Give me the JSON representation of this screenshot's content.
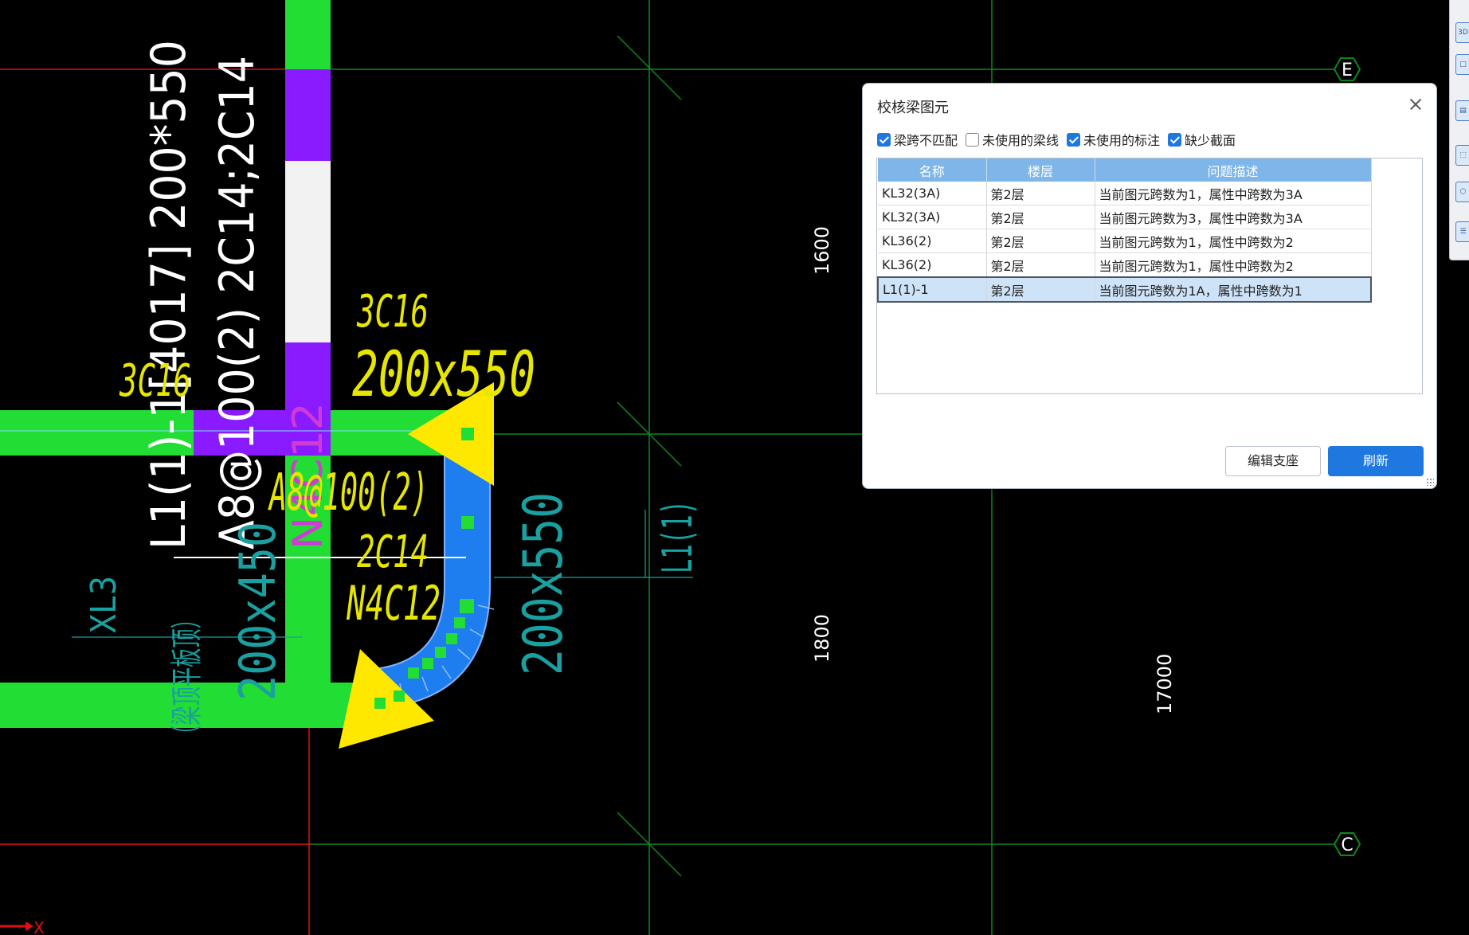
{
  "colors": {
    "background": "#000000",
    "beam_green": "#22dd33",
    "beam_purple": "#8a1aff",
    "beam_blue": "#1e7ef0",
    "axis_red": "#e01010",
    "grid_green": "#0b8a1a",
    "text_yellow": "#e6e600",
    "text_cyan": "#1aa0a0",
    "accent_blue": "#1f78e0"
  },
  "cad": {
    "label_white_1": "L1(1)-1[4017] 200*550",
    "label_white_2": "A8@100(2) 2C14;2C14",
    "label_magenta": "N4C12",
    "yellow_3c16_top": "3C16",
    "yellow_size": "200x550",
    "yellow_3c16_left": "3C16",
    "yellow_stirrup": "A8@100(2)",
    "yellow_2c14": "2C14",
    "yellow_n4c12": "N4C12",
    "cyan_xl3": "XL3",
    "cyan_note": "（梁顶平板顶）",
    "cyan_size_left": "200x450",
    "cyan_size_right": "200x550",
    "cyan_l1": "L1(1)",
    "dim_1600": "1600",
    "dim_1800": "1800",
    "dim_17000": "17000",
    "axis_e": "E",
    "axis_c": "C",
    "ucs_x": "X"
  },
  "toolstrip": {
    "items": [
      {
        "icon": "3d-view-icon",
        "glyph": "3D"
      },
      {
        "icon": "box-icon",
        "glyph": "□"
      },
      {
        "icon": "layer-icon",
        "glyph": "▤"
      },
      {
        "icon": "select-icon",
        "glyph": "⬚"
      },
      {
        "icon": "cube-icon",
        "glyph": "⬡"
      },
      {
        "icon": "list-icon",
        "glyph": "☰"
      }
    ]
  },
  "dialog": {
    "title": "校核梁图元",
    "filters": [
      {
        "label": "梁跨不匹配",
        "checked": true
      },
      {
        "label": "未使用的梁线",
        "checked": false
      },
      {
        "label": "未使用的标注",
        "checked": true
      },
      {
        "label": "缺少截面",
        "checked": true
      }
    ],
    "columns": [
      "名称",
      "楼层",
      "问题描述"
    ],
    "rows": [
      [
        "KL32(3A)",
        "第2层",
        "当前图元跨数为1，属性中跨数为3A"
      ],
      [
        "KL32(3A)",
        "第2层",
        "当前图元跨数为3，属性中跨数为3A"
      ],
      [
        "KL36(2)",
        "第2层",
        "当前图元跨数为1，属性中跨数为2"
      ],
      [
        "KL36(2)",
        "第2层",
        "当前图元跨数为1，属性中跨数为2"
      ],
      [
        "L1(1)-1",
        "第2层",
        "当前图元跨数为1A，属性中跨数为1"
      ]
    ],
    "selected_row": 4,
    "edit_button": "编辑支座",
    "refresh_button": "刷新"
  }
}
